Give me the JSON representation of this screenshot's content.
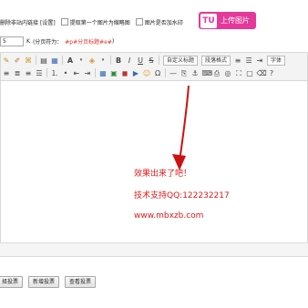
{
  "options": {
    "remove_links": "删除非站内链接",
    "settings": "[设置]",
    "first_image_thumb": "提取第一个图片为缩略图",
    "watermark": "图片是否加水印"
  },
  "upload_button": {
    "icon_text": "TU",
    "label": "上传图片",
    "color": "#e4399a"
  },
  "pagination": {
    "value": "5",
    "unit": "K",
    "tip_prefix": "(分页符为：",
    "tip_code": "#p#分页标题#e#",
    "tip_suffix": ")"
  },
  "toolbar": {
    "row1": {
      "custom_title": "自定义标题",
      "paragraph_format": "段落格式",
      "font": "字体"
    }
  },
  "content": {
    "line1": "效果出来了吧！",
    "line2": "技术支持QQ:122232217",
    "line3": "www.mbxzb.com",
    "text_color": "#e01818",
    "arrow_color": "#cc1111"
  },
  "buttons": {
    "pick_keywords": "择投票",
    "add_vote": "新增投票",
    "view_vote": "查看投票"
  }
}
